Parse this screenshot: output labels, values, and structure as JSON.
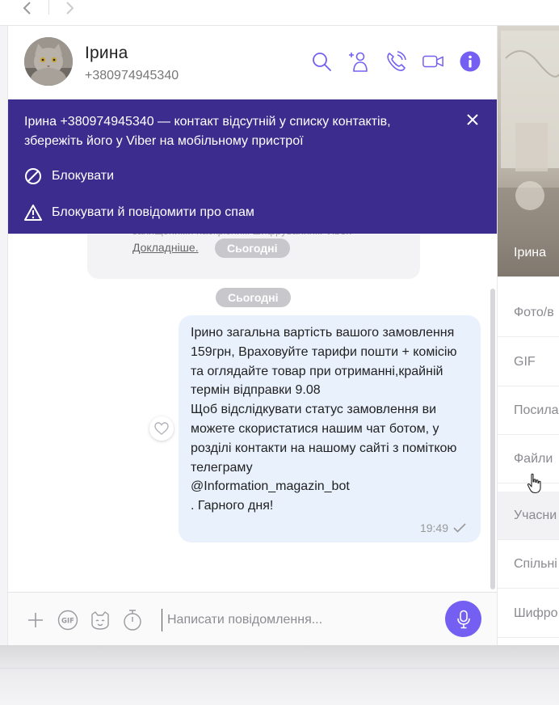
{
  "colors": {
    "accent": "#7360f2",
    "banner_bg": "#3b2c8e",
    "bubble_bg": "#e9f1fd",
    "date_pill": "#c7c7cc"
  },
  "nav": {
    "back_icon": "chevron-left-icon",
    "forward_icon": "chevron-right-icon"
  },
  "header": {
    "name": "Ірина",
    "phone": "+380974945340",
    "icons": [
      "search-icon",
      "add-contact-icon",
      "call-icon",
      "video-call-icon",
      "info-icon"
    ]
  },
  "banner": {
    "message": "Ірина +380974945340 — контакт відсутній у списку контактів, збережіть його у Viber на мобільному пристрої",
    "block_label": "Блокувати",
    "block_spam_label": "Блокувати й повідомити про спам"
  },
  "encryption_card": {
    "faded_text": "захищеними наскрізним шифруванням Viber.",
    "link_label": "Докладніше."
  },
  "dates": {
    "card_date": "Сьогодні",
    "separator_date": "Сьогодні"
  },
  "message": {
    "text": "Ірино загальна вартість вашого замовлення 159грн, Враховуйте тарифи пошти + комісію  та оглядайте товар при отриманні,крайній термін відправки 9.08\nЩоб відслідкувати статус замовлення ви можете скористатися нашим чат ботом, у розділі контакти на нашому сайті з поміткою телеграму\n@Information_magazin_bot\n. Гарного дня!",
    "time": "19:49",
    "status_icon": "check-icon"
  },
  "composer": {
    "placeholder": "Написати повідомлення...",
    "value": "",
    "icons": [
      "plus-icon",
      "gif-icon",
      "sticker-icon",
      "timer-icon",
      "microphone-icon"
    ]
  },
  "info_panel": {
    "photo_name": "Ірина",
    "items": [
      "Фото/в",
      "GIF",
      "Посила",
      "Файли",
      "Учасни",
      "Спільні",
      "Шифро"
    ]
  }
}
